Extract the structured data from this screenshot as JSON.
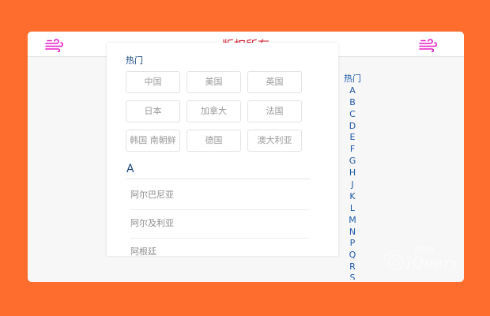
{
  "header": {
    "title": "版权所有",
    "icon_left": "wind-icon",
    "icon_right": "wind-icon",
    "icon_color": "#e81cc8"
  },
  "hot": {
    "label": "热门",
    "countries": [
      "中国",
      "美国",
      "英国",
      "日本",
      "加拿大",
      "法国",
      "韩国 南朝鲜",
      "德国",
      "澳大利亚"
    ]
  },
  "section": {
    "letter": "A",
    "countries": [
      "阿尔巴尼亚",
      "阿尔及利亚",
      "阿根廷"
    ]
  },
  "index": {
    "items": [
      "热门",
      "A",
      "B",
      "C",
      "D",
      "E",
      "F",
      "G",
      "H",
      "J",
      "K",
      "L",
      "M",
      "N",
      "P",
      "Q",
      "R",
      "S"
    ]
  },
  "watermark": {
    "brand": "jQuery",
    "subtitle": "插件库",
    "icon": "jquery-logo"
  },
  "colors": {
    "background": "#ff6d2e",
    "title": "#cf1a2b",
    "index": "#1d5aa8"
  }
}
